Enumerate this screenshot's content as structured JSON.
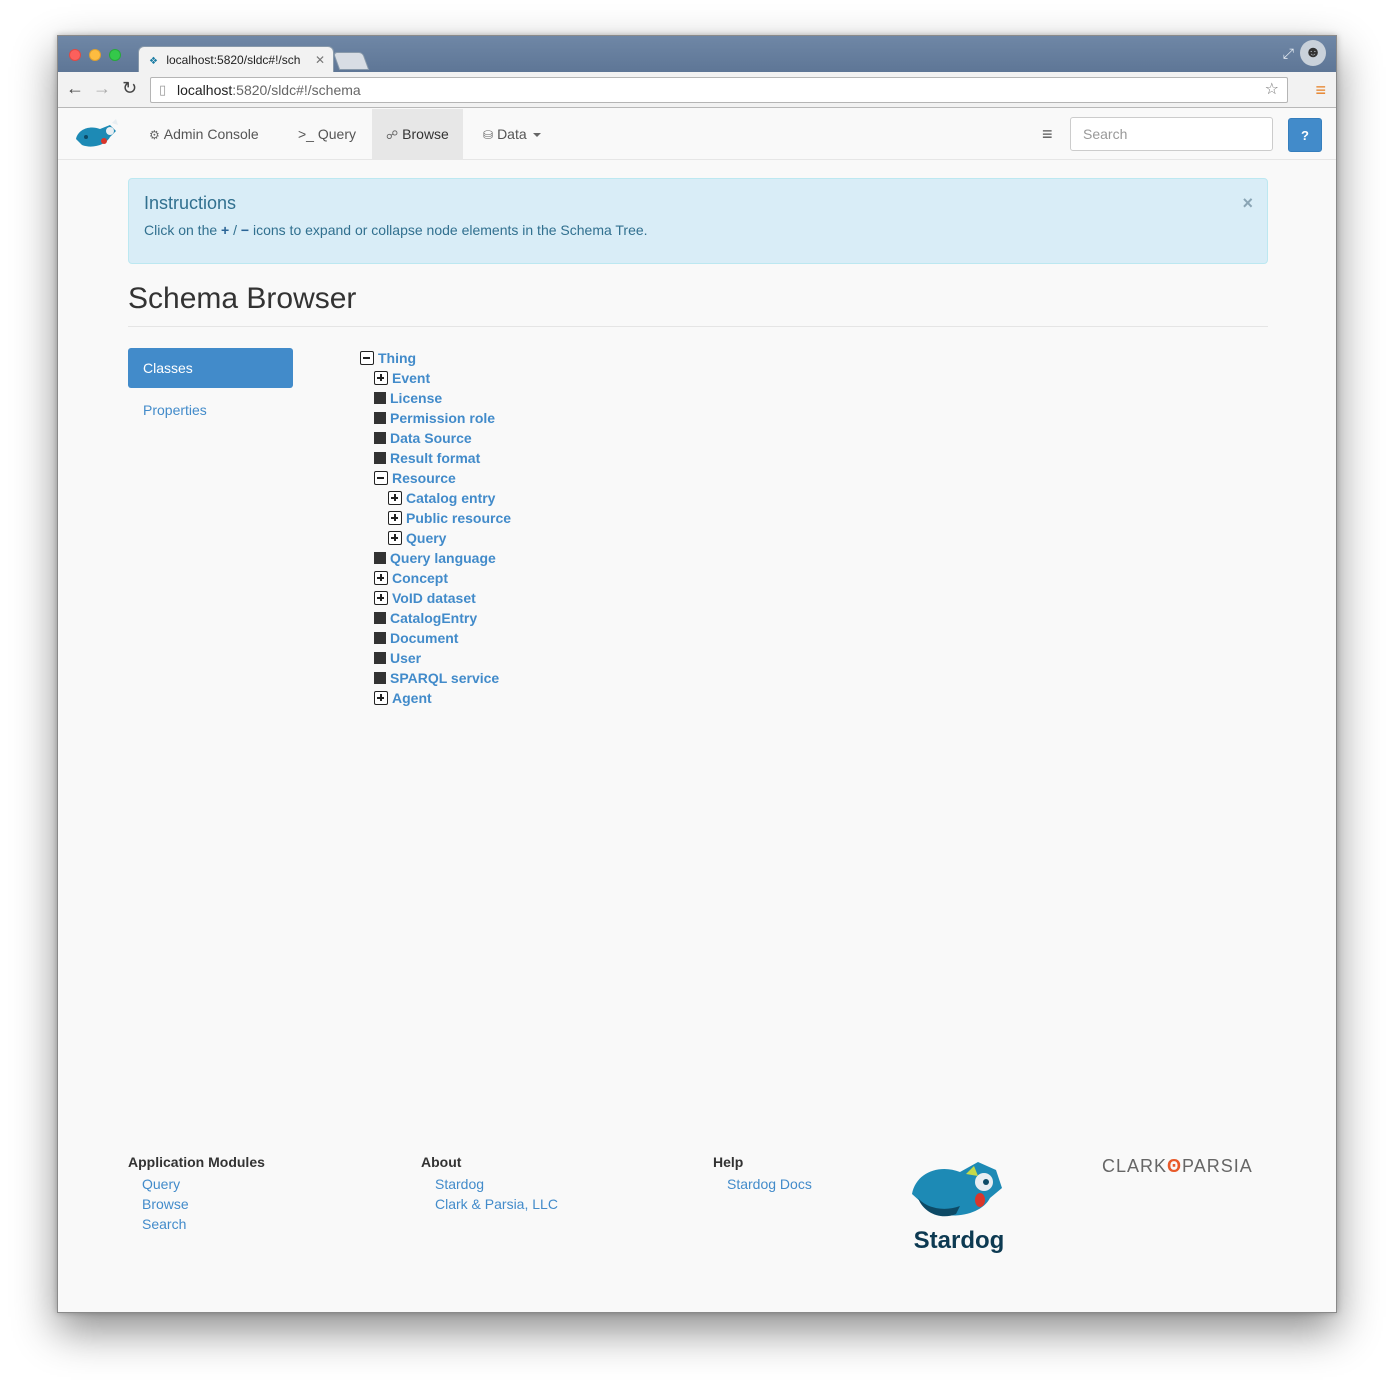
{
  "browser": {
    "tab_title": "localhost:5820/sldc#!/sch",
    "url_host": "localhost",
    "url_path": ":5820/sldc#!/schema"
  },
  "navbar": {
    "items": [
      {
        "label": "Admin Console",
        "icon": "cogs-icon"
      },
      {
        "label": ">_ Query",
        "icon": "terminal-icon"
      },
      {
        "label": "Browse",
        "icon": "sitemap-icon"
      },
      {
        "label": "Data",
        "icon": "database-icon"
      }
    ],
    "search_placeholder": "Search",
    "help_label": "?"
  },
  "alert": {
    "title": "Instructions",
    "text_before": "Click on the ",
    "plus": "+",
    "slash": " / ",
    "minus": "−",
    "text_after": " icons to expand or collapse node elements in the Schema Tree.",
    "close": "×"
  },
  "page": {
    "title": "Schema Browser",
    "pills": [
      "Classes",
      "Properties"
    ]
  },
  "tree": [
    {
      "label": "Thing",
      "state": "minus",
      "depth": 0
    },
    {
      "label": "Event",
      "state": "plus",
      "depth": 1
    },
    {
      "label": "License",
      "state": "leaf",
      "depth": 1
    },
    {
      "label": "Permission role",
      "state": "leaf",
      "depth": 1
    },
    {
      "label": "Data Source",
      "state": "leaf",
      "depth": 1
    },
    {
      "label": "Result format",
      "state": "leaf",
      "depth": 1
    },
    {
      "label": "Resource",
      "state": "minus",
      "depth": 1
    },
    {
      "label": "Catalog entry",
      "state": "plus",
      "depth": 2
    },
    {
      "label": "Public resource",
      "state": "plus",
      "depth": 2
    },
    {
      "label": "Query",
      "state": "plus",
      "depth": 2
    },
    {
      "label": "Query language",
      "state": "leaf",
      "depth": 1
    },
    {
      "label": "Concept",
      "state": "plus",
      "depth": 1
    },
    {
      "label": "VoID dataset",
      "state": "plus",
      "depth": 1
    },
    {
      "label": "CatalogEntry",
      "state": "leaf",
      "depth": 1
    },
    {
      "label": "Document",
      "state": "leaf",
      "depth": 1
    },
    {
      "label": "User",
      "state": "leaf",
      "depth": 1
    },
    {
      "label": "SPARQL service",
      "state": "leaf",
      "depth": 1
    },
    {
      "label": "Agent",
      "state": "plus",
      "depth": 1
    }
  ],
  "footer": {
    "modules": {
      "heading": "Application Modules",
      "links": [
        "Query",
        "Browse",
        "Search"
      ]
    },
    "about": {
      "heading": "About",
      "links": [
        "Stardog",
        "Clark & Parsia, LLC"
      ]
    },
    "help": {
      "heading": "Help",
      "links": [
        "Stardog Docs"
      ]
    },
    "logo_text": "Stardog",
    "clark_left": "CLARK",
    "clark_right": "PARSIA"
  },
  "colors": {
    "accent": "#428bca",
    "alert_bg": "#d9edf7",
    "alert_text": "#31708f",
    "clark_mark": "#e85a2a"
  }
}
